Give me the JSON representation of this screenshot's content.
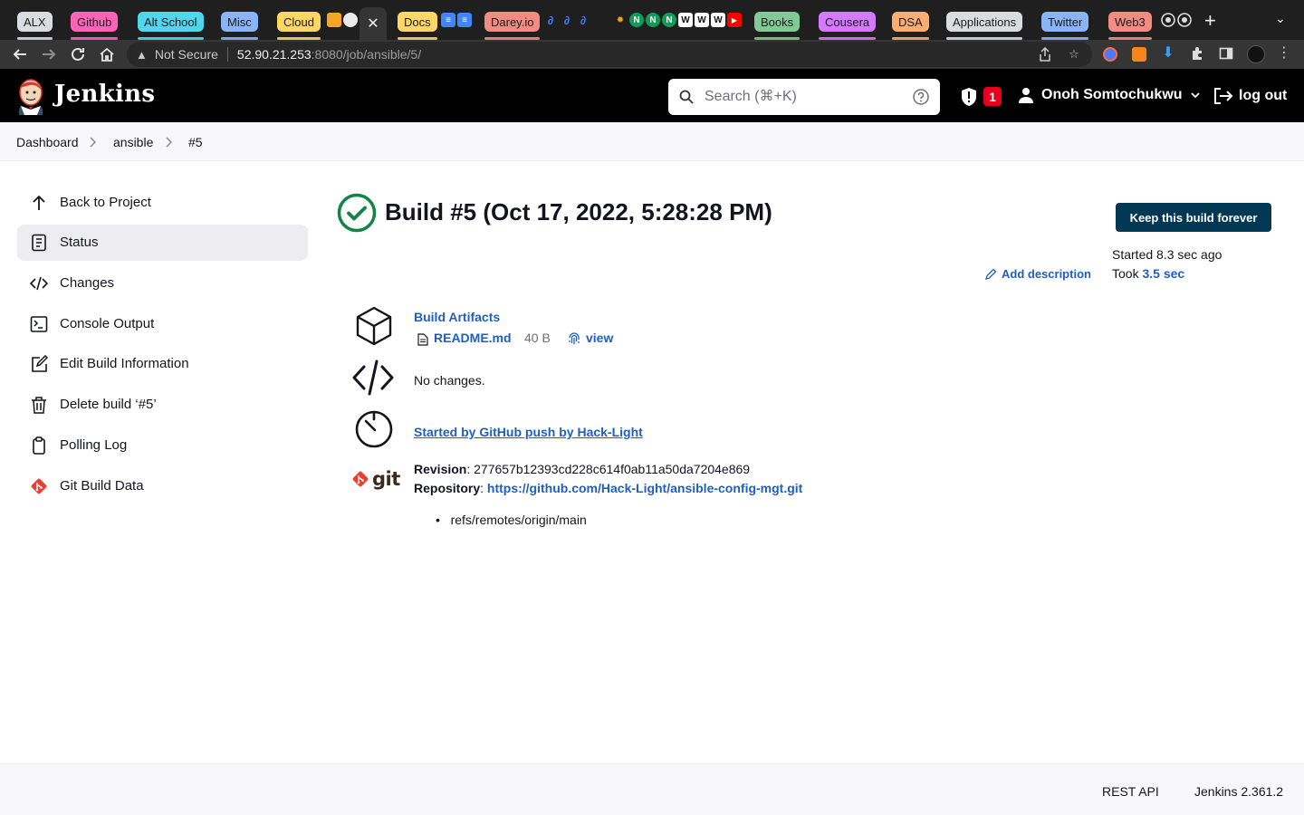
{
  "browser": {
    "tab_groups": [
      {
        "label": "ALX",
        "color": "#dadce0"
      },
      {
        "label": "Github",
        "color": "#ff63b8"
      },
      {
        "label": "Alt School",
        "color": "#4fd8eb"
      },
      {
        "label": "Misc",
        "color": "#8ab4f8"
      },
      {
        "label": "Cloud",
        "color": "#fdd663"
      },
      {
        "label": "Docs",
        "color": "#fdd663"
      },
      {
        "label": "Darey.io",
        "color": "#f28b82"
      },
      {
        "label": "Books",
        "color": "#81c995"
      },
      {
        "label": "Cousera",
        "color": "#d57aff"
      },
      {
        "label": "DSA",
        "color": "#fcad70"
      },
      {
        "label": "Applications",
        "color": "#dadce0"
      },
      {
        "label": "Twitter",
        "color": "#8ab4f8"
      },
      {
        "label": "Web3",
        "color": "#f28b82"
      }
    ],
    "address": {
      "security_label": "Not Secure",
      "host": "52.90.21.253",
      "path": ":8080/job/ansible/5/"
    }
  },
  "header": {
    "brand": "Jenkins",
    "search_placeholder": "Search (⌘+K)",
    "security_count": "1",
    "user_name": "Onoh Somtochukwu",
    "logout_label": "log out"
  },
  "breadcrumb": {
    "items": [
      "Dashboard",
      "ansible",
      "#5"
    ]
  },
  "sidebar": {
    "items": [
      {
        "label": "Back to Project",
        "icon": "arrow-up-icon"
      },
      {
        "label": "Status",
        "icon": "document-icon"
      },
      {
        "label": "Changes",
        "icon": "code-icon"
      },
      {
        "label": "Console Output",
        "icon": "terminal-icon"
      },
      {
        "label": "Edit Build Information",
        "icon": "edit-icon"
      },
      {
        "label": "Delete build ‘#5’",
        "icon": "trash-icon"
      },
      {
        "label": "Polling Log",
        "icon": "clipboard-icon"
      },
      {
        "label": "Git Build Data",
        "icon": "git-icon"
      }
    ]
  },
  "build": {
    "title": "Build #5 (Oct 17, 2022, 5:28:28 PM)",
    "keep_button": "Keep this build forever",
    "started_label": "Started 8.3 sec ago",
    "took_prefix": "Took",
    "took_value": "3.5 sec",
    "add_description": "Add description",
    "artifacts": {
      "heading": "Build Artifacts",
      "file_name": "README.md",
      "file_size": "40 B",
      "view_label": "view"
    },
    "changes_text": "No changes.",
    "cause_text": "Started by GitHub push by Hack-Light",
    "git": {
      "logo_text": "git",
      "revision_label": "Revision",
      "revision_value": "277657b12393cd228c614f0ab11a50da7204e869",
      "repository_label": "Repository",
      "repository_url": "https://github.com/Hack-Light/ansible-config-mgt.git",
      "branch": "refs/remotes/origin/main"
    }
  },
  "footer": {
    "rest_api": "REST API",
    "version": "Jenkins 2.361.2"
  },
  "colors": {
    "link": "#1f5fbf",
    "success": "#138347",
    "keep_button": "#023853",
    "badge": "#e6001f"
  }
}
